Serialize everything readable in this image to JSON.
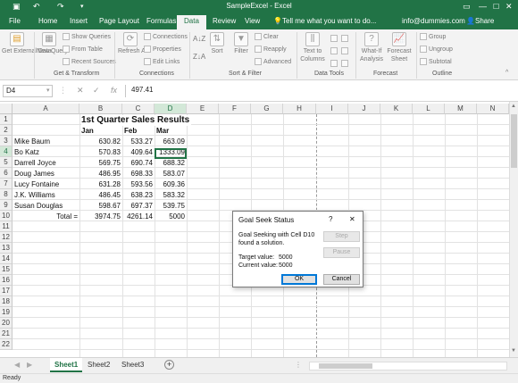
{
  "titlebar": {
    "file_label": "File",
    "title": "SampleExcel - Excel",
    "signin": "info@dummies.com",
    "share": "Share",
    "tell_me": "Tell me what you want to do...",
    "share_icon": "person-icon",
    "undo_icon": "undo-icon",
    "redo_icon": "redo-icon",
    "save_icon": "save-icon"
  },
  "tabs": [
    "Home",
    "Insert",
    "Page Layout",
    "Formulas",
    "Data",
    "Review",
    "View"
  ],
  "active_tab": "Data",
  "ribbon": {
    "get_external_data": "Get External Data",
    "new_query": "New Query",
    "show_queries": "Show Queries",
    "from_table": "From Table",
    "recent_sources": "Recent Sources",
    "group_get_transform": "Get & Transform",
    "refresh_all": "Refresh All",
    "connections": "Connections",
    "properties": "Properties",
    "edit_links": "Edit Links",
    "group_connections": "Connections",
    "sort": "Sort",
    "filter": "Filter",
    "clear": "Clear",
    "reapply": "Reapply",
    "advanced": "Advanced",
    "group_sort_filter": "Sort & Filter",
    "text_to_columns": "Text to Columns",
    "group_data_tools": "Data Tools",
    "what_if": "What-If Analysis",
    "forecast_sheet": "Forecast Sheet",
    "group_forecast": "Forecast",
    "group": "Group",
    "ungroup": "Ungroup",
    "subtotal": "Subtotal",
    "group_outline": "Outline"
  },
  "formula_bar": {
    "name_box": "D4",
    "formula": "497.41",
    "fx": "fx"
  },
  "columns": [
    "A",
    "B",
    "C",
    "D",
    "E",
    "F",
    "G",
    "H",
    "I",
    "J",
    "K",
    "L",
    "M",
    "N"
  ],
  "rows": [
    "1",
    "2",
    "3",
    "4",
    "5",
    "6",
    "7",
    "8",
    "9",
    "10",
    "11",
    "12",
    "13",
    "14",
    "15",
    "16",
    "17",
    "18",
    "19",
    "20",
    "21",
    "22"
  ],
  "sheet": {
    "title": "1st Quarter Sales Results",
    "headers": [
      "Jan",
      "Feb",
      "Mar"
    ],
    "data": [
      [
        "Mike Baum",
        "630.82",
        "533.27",
        "663.09"
      ],
      [
        "Bo Katz",
        "570.83",
        "409.64",
        "1333.09"
      ],
      [
        "Darrell Joyce",
        "569.75",
        "690.74",
        "688.32"
      ],
      [
        "Doug James",
        "486.95",
        "698.33",
        "583.07"
      ],
      [
        "Lucy Fontaine",
        "631.28",
        "593.56",
        "609.36"
      ],
      [
        "J.K. Williams",
        "486.45",
        "638.23",
        "583.32"
      ],
      [
        "Susan Douglas",
        "598.67",
        "697.37",
        "539.75"
      ],
      [
        "Total =",
        "3974.75",
        "4261.14",
        "5000"
      ]
    ]
  },
  "dialog": {
    "title": "Goal Seek Status",
    "help": "?",
    "close": "✕",
    "message1": "Goal Seeking with Cell D10",
    "message2": "found a solution.",
    "target_label": "Target value:",
    "target_value": "5000",
    "current_label": "Current value:",
    "current_value": "5000",
    "step": "Step",
    "pause": "Pause",
    "ok": "OK",
    "cancel": "Cancel"
  },
  "sheet_tabs": [
    "Sheet1",
    "Sheet2",
    "Sheet3"
  ],
  "active_sheet": "Sheet1",
  "add_sheet": "+",
  "status": "Ready"
}
